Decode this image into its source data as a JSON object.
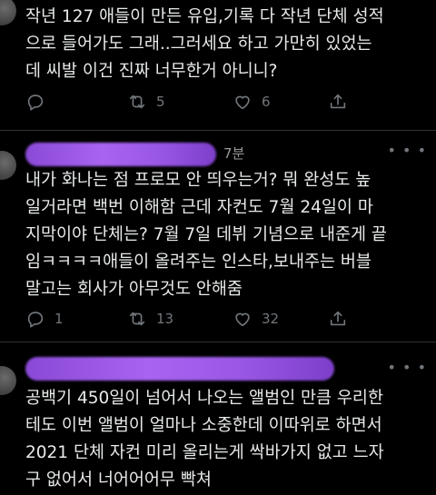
{
  "tweets": [
    {
      "text": "작년 127 애들이 만든 유입,기록 다 작년 단체 성적\n으로 들어가도 그래..그러세요 하고 가만히 있었는\n데 씨발 이건 진짜 너무한거 아니니?",
      "replies": "",
      "retweets": "5",
      "likes": "6"
    },
    {
      "time": "7분",
      "text": "내가 화나는 점 프로모 안 띄우는거? 뭐 완성도 높\n일거라면 백번 이해함 근데 자컨도 7월 24일이 마\n지막이야 단체는? 7월 7일 데뷔 기념으로 내준게 끝\n임ㅋㅋㅋㅋ애들이 올려주는 인스타,보내주는 버블\n말고는 회사가 아무것도 안해줌",
      "replies": "1",
      "retweets": "13",
      "likes": "32"
    },
    {
      "text": "공백기 450일이 넘어서 나오는 앨범인 만큼 우리한\n테도 이번 앨범이 얼마나 소중한데 이따위로 하면서\n2021 단체 자컨 미리 올리는게 싹바가지 없고 느자\n구 없어서 너어어어무 빡쳐"
    }
  ],
  "icons": {
    "reply": "reply-icon",
    "retweet": "retweet-icon",
    "like": "heart-icon",
    "share": "share-icon",
    "more": "more-icon"
  },
  "colors": {
    "background": "#000000",
    "text": "#e7e9ea",
    "muted": "#71767b",
    "censor": "#9a57e6"
  }
}
